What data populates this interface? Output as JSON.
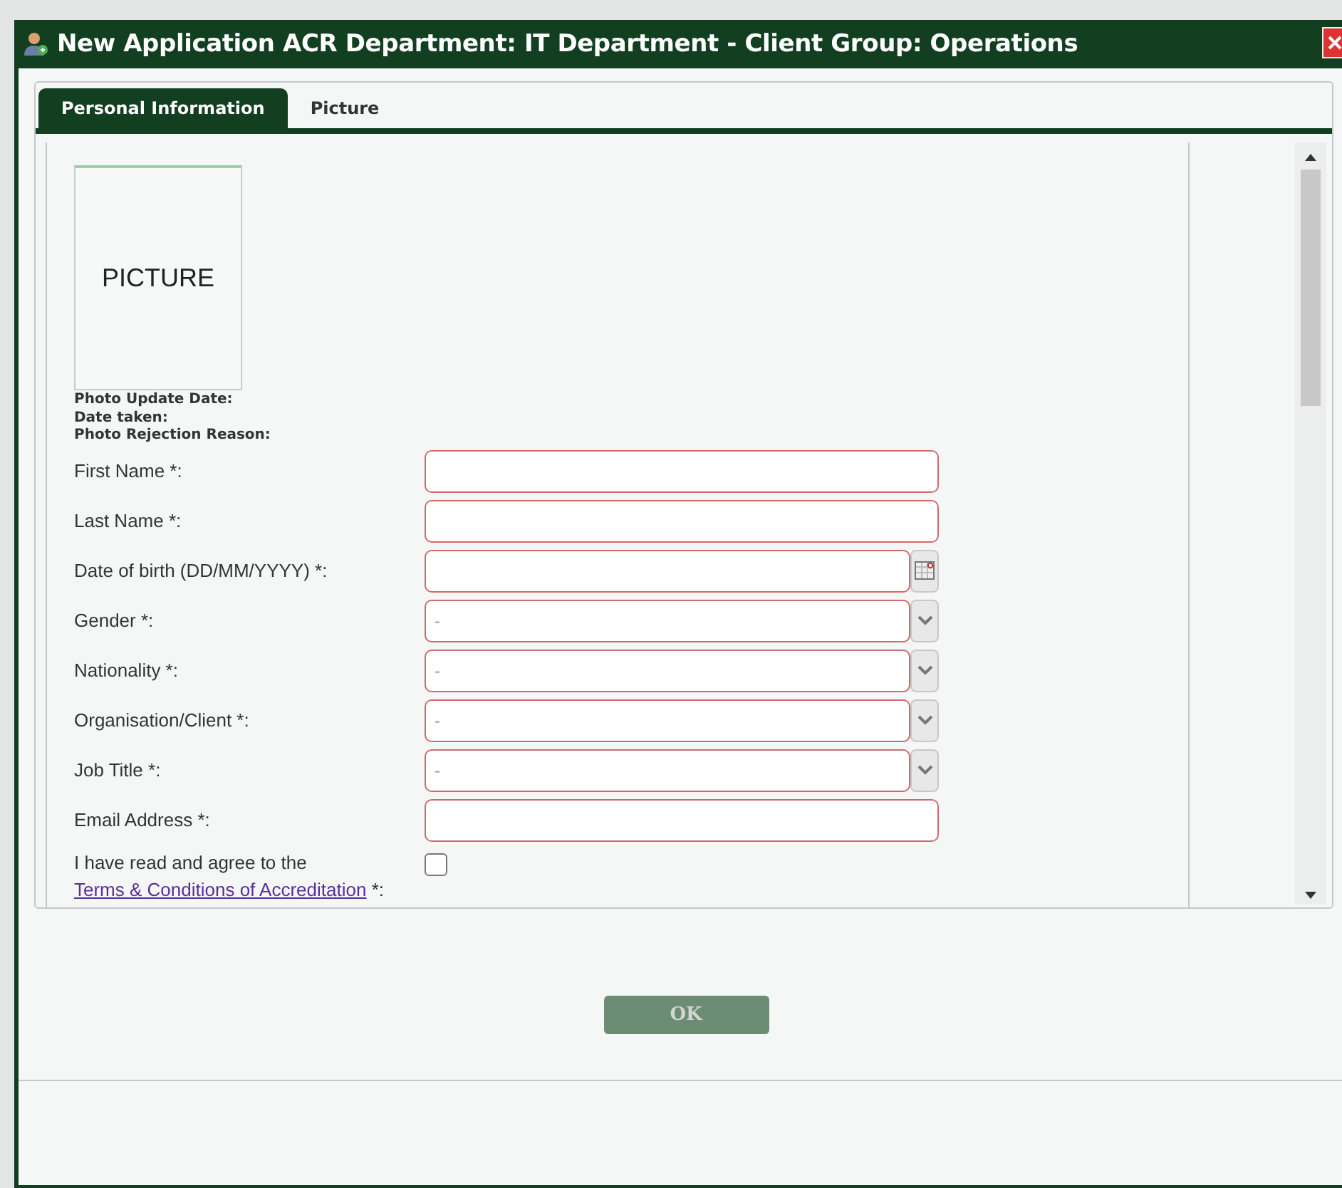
{
  "window": {
    "title": "New Application ACR Department: IT Department - Client Group: Operations"
  },
  "tabs": [
    {
      "label": "Personal Information",
      "selected": true
    },
    {
      "label": "Picture",
      "selected": false
    }
  ],
  "photo": {
    "placeholder": "PICTURE",
    "details": [
      "Photo Update Date:",
      "Date taken:",
      "Photo Rejection Reason:"
    ]
  },
  "fields": [
    {
      "label": "First Name *:",
      "kind": "text",
      "invalid": true
    },
    {
      "label": "Last Name *:",
      "kind": "text",
      "invalid": true
    },
    {
      "label": "Date of birth (DD/MM/YYYY) *:",
      "kind": "date",
      "invalid": true
    },
    {
      "label": "Gender *:",
      "kind": "select",
      "value": "-",
      "invalid": true
    },
    {
      "label": "Nationality *:",
      "kind": "select",
      "value": "-",
      "invalid": true
    },
    {
      "label": "Organisation/Client *:",
      "kind": "select",
      "value": "-",
      "invalid": true
    },
    {
      "label": "Job Title *:",
      "kind": "select",
      "value": "-",
      "invalid": true
    },
    {
      "label": "Email Address *:",
      "kind": "text",
      "invalid": true
    }
  ],
  "agreement": {
    "text": "I have read and agree to the",
    "link": "Terms & Conditions of Accreditation",
    "suffix": "*:",
    "checked": false
  },
  "buttons": [
    {
      "label": "OK",
      "disabled": true
    }
  ]
}
